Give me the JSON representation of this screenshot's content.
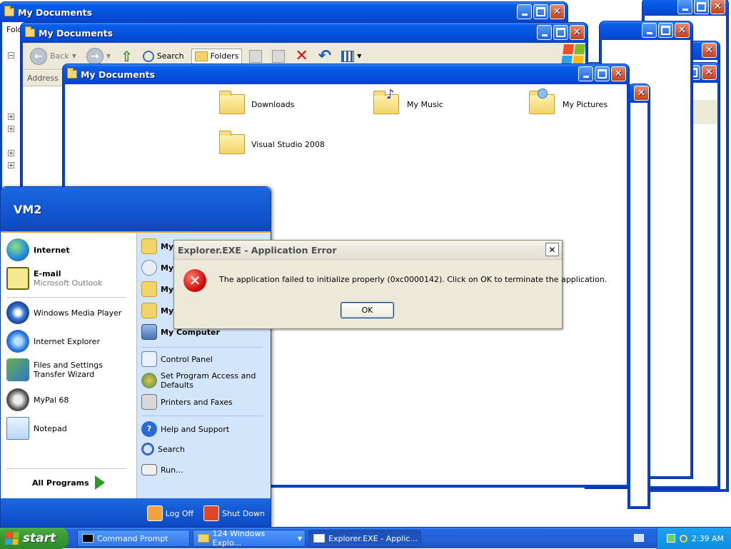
{
  "windows": {
    "back_title": "My Documents",
    "mid_title": "My Documents",
    "front_title": "My Documents",
    "folder_menu_fragment": "Fold",
    "address_label": "Address"
  },
  "toolbar": {
    "back": "Back",
    "search": "Search",
    "folders": "Folders"
  },
  "folder_items": [
    {
      "label": "Downloads"
    },
    {
      "label": "My Music"
    },
    {
      "label": "My Pictures"
    },
    {
      "label": "Visual Studio 2008"
    }
  ],
  "start_menu": {
    "user": "VM2",
    "left_items": [
      {
        "title": "Internet",
        "subtitle": ""
      },
      {
        "title": "E-mail",
        "subtitle": "Microsoft Outlook"
      },
      {
        "title": "Windows Media Player",
        "subtitle": ""
      },
      {
        "title": "Internet Explorer",
        "subtitle": ""
      },
      {
        "title": "Files and Settings Transfer Wizard",
        "subtitle": ""
      },
      {
        "title": "MyPal 68",
        "subtitle": ""
      },
      {
        "title": "Notepad",
        "subtitle": ""
      }
    ],
    "all_programs": "All Programs",
    "right_items": [
      {
        "label": "My"
      },
      {
        "label": "My"
      },
      {
        "label": "My"
      },
      {
        "label": "My"
      },
      {
        "label": "My Computer"
      },
      {
        "label": "Control Panel"
      },
      {
        "label": "Set Program Access and Defaults"
      },
      {
        "label": "Printers and Faxes"
      },
      {
        "label": "Help and Support"
      },
      {
        "label": "Search"
      },
      {
        "label": "Run..."
      }
    ],
    "log_off": "Log Off",
    "shut_down": "Shut Down"
  },
  "dialog": {
    "title": "Explorer.EXE - Application Error",
    "message": "The application failed to initialize properly (0xc0000142). Click on OK to terminate the application.",
    "ok": "OK"
  },
  "taskbar": {
    "start": "start",
    "tasks": [
      {
        "label": "Command Prompt"
      },
      {
        "label": "124 Windows Explo..."
      },
      {
        "label": "Explorer.EXE - Applic..."
      }
    ],
    "clock": "2:39 AM"
  },
  "colors": {
    "titlebar_blue": "#0553e0",
    "start_green": "#3a9a35",
    "error_red": "#d10a0a",
    "dialog_bg": "#ece9d8"
  }
}
